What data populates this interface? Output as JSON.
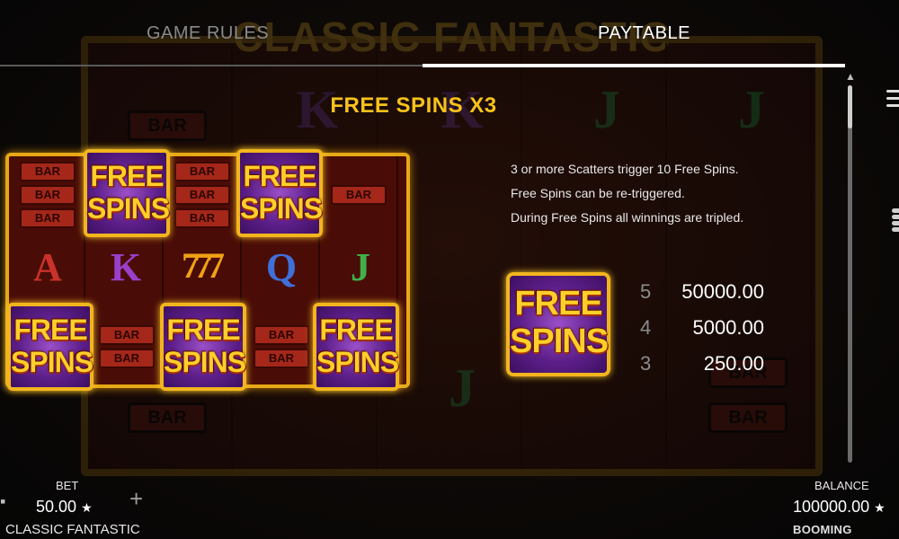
{
  "tabs": [
    {
      "label": "GAME RULES",
      "active": false
    },
    {
      "label": "PAYTABLE",
      "active": true
    }
  ],
  "background": {
    "title": "CLASSIC FANTASTIC"
  },
  "section": {
    "title": "FREE SPINS X3"
  },
  "symbols": {
    "bar": "BAR",
    "a": "A",
    "k": "K",
    "q": "Q",
    "j": "J",
    "seven": "777",
    "free_spins_line1": "FREE",
    "free_spins_line2": "SPINS"
  },
  "description": [
    "3 or more Scatters trigger 10 Free Spins.",
    "Free Spins can be re-triggered.",
    "During Free Spins all winnings are tripled."
  ],
  "payouts": [
    {
      "count": "5",
      "value": "50000.00"
    },
    {
      "count": "4",
      "value": "5000.00"
    },
    {
      "count": "3",
      "value": "250.00"
    }
  ],
  "footer": {
    "bet_label": "BET",
    "bet_value": "50.00",
    "game_name": "CLASSIC FANTASTIC",
    "balance_label": "BALANCE",
    "balance_value": "100000.00",
    "brand": "BOOMING GAMES"
  },
  "colors": {
    "accent_gold": "#f7c31b",
    "reel_red": "#4a0c06",
    "tile_purple": "#5d1f8a"
  },
  "icons": [
    "minus-icon",
    "plus-icon",
    "star-icon",
    "menu-icon",
    "coins-icon",
    "scroll-up-arrow-icon"
  ]
}
